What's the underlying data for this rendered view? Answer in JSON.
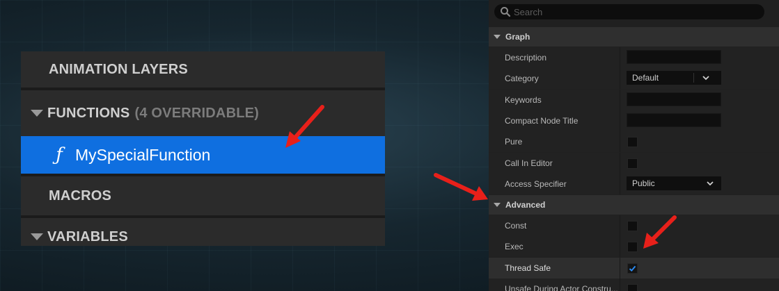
{
  "my_blueprint": {
    "sections": {
      "animation_layers": "ANIMATION LAYERS",
      "functions": "FUNCTIONS",
      "functions_count": "(4 OVERRIDABLE)",
      "macros": "MACROS",
      "variables": "VARIABLES"
    },
    "functions": [
      {
        "label": "MySpecialFunction",
        "icon": "function-icon",
        "selected": true
      }
    ]
  },
  "details": {
    "search": {
      "placeholder": "Search",
      "value": ""
    },
    "graph_section": {
      "title": "Graph",
      "properties": {
        "description": "Description",
        "category": "Category",
        "category_value": "Default",
        "keywords": "Keywords",
        "compact_node_title": "Compact Node Title",
        "pure": "Pure",
        "call_in_editor": "Call In Editor",
        "access_specifier": "Access Specifier",
        "access_specifier_value": "Public"
      }
    },
    "advanced_section": {
      "title": "Advanced",
      "properties": {
        "const": "Const",
        "exec": "Exec",
        "thread_safe": "Thread Safe",
        "unsafe_during_actor_construction": "Unsafe During Actor Constru..."
      },
      "values": {
        "pure": false,
        "call_in_editor": false,
        "const": false,
        "exec": false,
        "thread_safe": true,
        "unsafe_during_actor_construction": false
      }
    }
  },
  "colors": {
    "selection_blue": "#0F6FE0",
    "annotation_red": "#E8201A",
    "checkbox_blue": "#2A8BF2",
    "panel_bg": "#2B2B2B"
  }
}
